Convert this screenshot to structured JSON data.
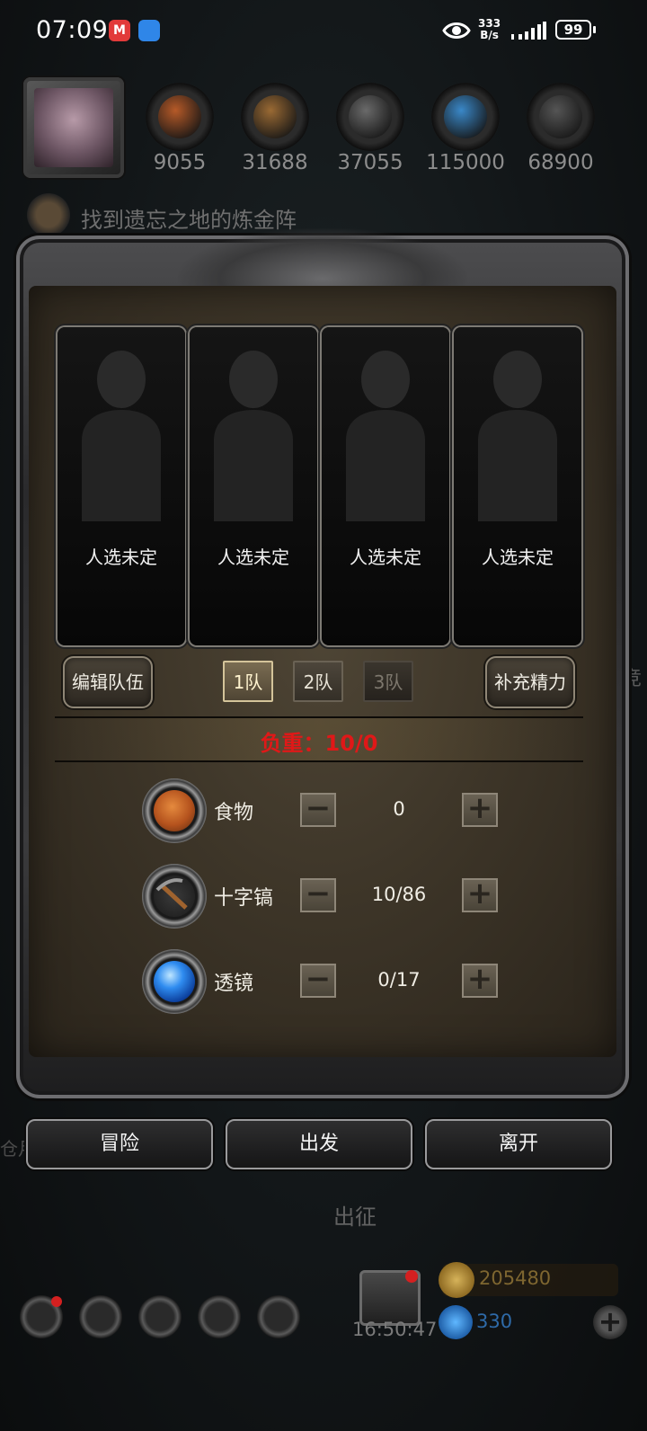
{
  "status_bar": {
    "time": "07:09",
    "net_speed_value": "333",
    "net_speed_unit": "B/s",
    "battery": "99"
  },
  "resources": [
    {
      "name": "food",
      "value": "9055",
      "color": "#b65a28"
    },
    {
      "name": "wood",
      "value": "31688",
      "color": "#9a6a34"
    },
    {
      "name": "iron",
      "value": "37055",
      "color": "#6a6a6a"
    },
    {
      "name": "crystal",
      "value": "115000",
      "color": "#3a88c8"
    },
    {
      "name": "stone",
      "value": "68900",
      "color": "#555555"
    }
  ],
  "quest": {
    "text": "找到遗忘之地的炼金阵"
  },
  "team_slots": [
    "人选未定",
    "人选未定",
    "人选未定",
    "人选未定"
  ],
  "controls": {
    "edit_team": "编辑队伍",
    "restore_stamina": "补充精力",
    "tabs": [
      "1队",
      "2队",
      "3队"
    ],
    "selected_tab": "1队"
  },
  "load": {
    "label": "负重：10/0"
  },
  "supplies": [
    {
      "name": "食物",
      "value": "0",
      "icon": "food-icon"
    },
    {
      "name": "十字镐",
      "value": "10/86",
      "icon": "pickaxe-icon"
    },
    {
      "name": "透镜",
      "value": "0/17",
      "icon": "lens-icon"
    }
  ],
  "actions": {
    "adventure": "冒险",
    "depart": "出发",
    "leave": "离开"
  },
  "expedition_label": "出征",
  "bottom": {
    "timer": "16:50:47",
    "gold": "205480",
    "gems": "330",
    "side_text": "竞",
    "side_text_2": "仓月"
  }
}
